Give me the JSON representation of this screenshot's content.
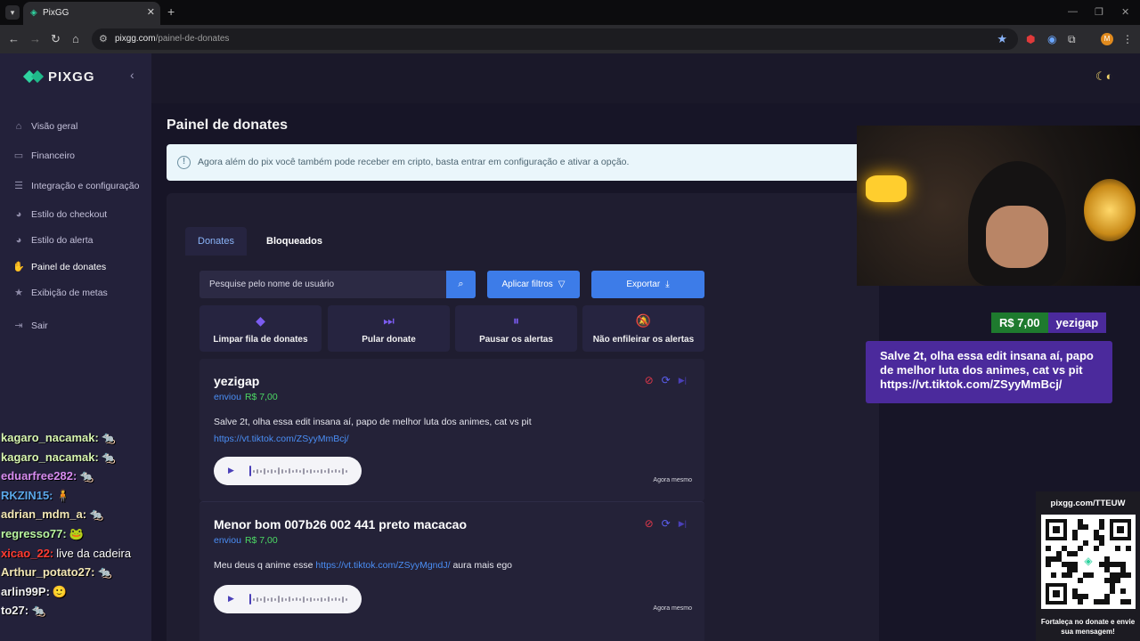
{
  "browser": {
    "tab_title": "PixGG",
    "url_domain": "pixgg.com",
    "url_path": "/painel-de-donates",
    "profile_initial": "M"
  },
  "sidebar": {
    "logo": "PIXGG",
    "items": [
      {
        "label": "Visão geral",
        "icon": "home-icon"
      },
      {
        "label": "Financeiro",
        "icon": "wallet-icon"
      },
      {
        "label": "Integração e configuração",
        "icon": "settings-icon"
      },
      {
        "label": "Estilo do checkout",
        "icon": "palette-icon"
      },
      {
        "label": "Estilo do alerta",
        "icon": "palette-icon"
      },
      {
        "label": "Painel de donates",
        "icon": "donate-hand-icon"
      },
      {
        "label": "Exibição de metas",
        "icon": "star-icon"
      },
      {
        "label": "Sair",
        "icon": "logout-icon"
      }
    ],
    "active_index": 5
  },
  "page": {
    "title": "Painel de donates",
    "info_banner": "Agora além do pix você também pode receber em cripto, basta entrar em configuração e ativar a opção."
  },
  "tabs": [
    {
      "label": "Donates",
      "active": true
    },
    {
      "label": "Bloqueados",
      "active": false
    }
  ],
  "toolbar": {
    "search_placeholder": "Pesquise pelo nome de usuário",
    "filter_label": "Aplicar filtros",
    "export_label": "Exportar"
  },
  "actions": [
    {
      "label": "Limpar fila de donates",
      "icon": "eraser-icon"
    },
    {
      "label": "Pular donate",
      "icon": "skip-icon"
    },
    {
      "label": "Pausar os alertas",
      "icon": "pause-icon"
    },
    {
      "label": "Não enfileirar os alertas",
      "icon": "bell-off-icon"
    }
  ],
  "donates": [
    {
      "name": "yezigap",
      "sent_label": "enviou",
      "amount": "R$ 7,00",
      "message": "Salve 2t, olha essa edit insana aí, papo de melhor luta dos animes, cat vs pit",
      "link": "https://vt.tiktok.com/ZSyyMmBcj/",
      "message_after": "",
      "time": "Agora mesmo"
    },
    {
      "name": "Menor bom 007b26 002 441 preto macacao",
      "sent_label": "enviou",
      "amount": "R$ 7,00",
      "message": "Meu deus q anime esse",
      "link": "https://vt.tiktok.com/ZSyyMgndJ/",
      "message_after": "aura mais ego",
      "time": "Agora mesmo"
    }
  ],
  "overlay": {
    "alert_amount": "R$ 7,00",
    "alert_user": "yezigap",
    "alert_message": "Salve 2t, olha essa edit insana aí, papo de melhor luta dos animes, cat vs pit https://vt.tiktok.com/ZSyyMmBcj/",
    "qr_url": "pixgg.com/TTEUW",
    "qr_caption": "Fortaleça no donate e envie sua mensagem!"
  },
  "chat": [
    {
      "user": "kagaro_nacamak:",
      "color": "#d7f5b0",
      "message": "",
      "emote": "🐀"
    },
    {
      "user": "kagaro_nacamak:",
      "color": "#d7f5b0",
      "message": "",
      "emote": "🐀"
    },
    {
      "user": "eduarfree282:",
      "color": "#d78cf0",
      "message": "",
      "emote": "🐀"
    },
    {
      "user": "RKZIN15:",
      "color": "#5aa7e8",
      "message": "",
      "emote": "🧍"
    },
    {
      "user": "adrian_mdm_a:",
      "color": "#f3e7b5",
      "message": "",
      "emote": "🐀"
    },
    {
      "user": "regresso77:",
      "color": "#b9f5a0",
      "message": "",
      "emote": "🐸"
    },
    {
      "user": "xicao_22:",
      "color": "#ff3b30",
      "message": "live da cadeira",
      "emote": ""
    },
    {
      "user": "Arthur_potato27:",
      "color": "#f3e7b5",
      "message": "",
      "emote": "🐀"
    },
    {
      "user": "arlin99P:",
      "color": "#f0f0f0",
      "message": "",
      "emote": "🙂"
    },
    {
      "user": "to27:",
      "color": "#f0f0f0",
      "message": "",
      "emote": "🐀"
    }
  ],
  "colors": {
    "accent": "#3d7ce8",
    "amount_green": "#4cd964",
    "alert_purple": "#4b2a9c",
    "brand_green": "#2fd3a0"
  }
}
